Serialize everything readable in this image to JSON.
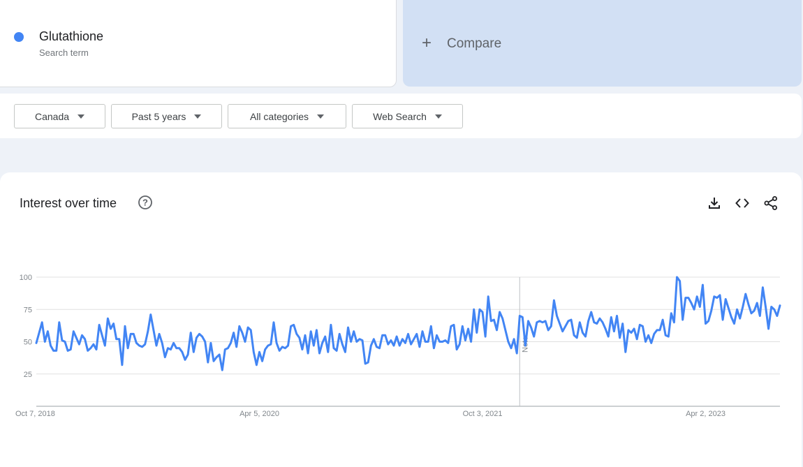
{
  "search_term": {
    "name": "Glutathione",
    "subtitle": "Search term",
    "color": "#4285f4"
  },
  "compare": {
    "label": "Compare",
    "icon": "plus-icon"
  },
  "filters": [
    {
      "label": "Canada",
      "icon": "caret-down-icon"
    },
    {
      "label": "Past 5 years",
      "icon": "caret-down-icon"
    },
    {
      "label": "All categories",
      "icon": "caret-down-icon"
    },
    {
      "label": "Web Search",
      "icon": "caret-down-icon"
    }
  ],
  "section": {
    "title": "Interest over time",
    "icons": [
      "help-icon",
      "download-icon",
      "embed-icon",
      "share-icon"
    ]
  },
  "chart_data": {
    "type": "line",
    "title": "Interest over time",
    "xlabel": "",
    "ylabel": "",
    "ylim": [
      0,
      100
    ],
    "yticks": [
      25,
      50,
      75,
      100
    ],
    "x_tick_labels": [
      "Oct 7, 2018",
      "Apr 5, 2020",
      "Oct 3, 2021",
      "Apr 2, 2023"
    ],
    "grid": true,
    "legend": "none",
    "annotation": {
      "label": "Note",
      "date": "2022-01-02"
    },
    "x_start": "2018-10-07",
    "x_step_days": 7,
    "series": [
      {
        "color": "#4285f4",
        "values": [
          49,
          57,
          65,
          50,
          58,
          47,
          43,
          43,
          65,
          51,
          50,
          43,
          44,
          58,
          53,
          48,
          55,
          52,
          43,
          45,
          48,
          44,
          63,
          55,
          47,
          68,
          60,
          64,
          52,
          52,
          32,
          62,
          45,
          56,
          56,
          49,
          47,
          46,
          48,
          58,
          71,
          59,
          47,
          56,
          49,
          38,
          45,
          44,
          49,
          45,
          45,
          42,
          36,
          40,
          57,
          42,
          53,
          56,
          54,
          50,
          34,
          49,
          35,
          38,
          40,
          28,
          44,
          45,
          49,
          57,
          46,
          62,
          57,
          50,
          61,
          59,
          42,
          32,
          42,
          35,
          44,
          47,
          48,
          65,
          49,
          43,
          46,
          45,
          47,
          62,
          63,
          56,
          53,
          44,
          55,
          41,
          58,
          47,
          59,
          41,
          49,
          54,
          42,
          63,
          45,
          43,
          56,
          48,
          42,
          61,
          50,
          58,
          50,
          52,
          51,
          33,
          34,
          47,
          52,
          46,
          45,
          55,
          55,
          48,
          51,
          47,
          54,
          47,
          52,
          49,
          56,
          48,
          52,
          56,
          46,
          58,
          50,
          50,
          62,
          45,
          55,
          50,
          50,
          51,
          49,
          62,
          63,
          44,
          48,
          62,
          51,
          60,
          50,
          75,
          57,
          75,
          73,
          54,
          85,
          66,
          67,
          59,
          73,
          68,
          59,
          50,
          45,
          52,
          41,
          70,
          69,
          47,
          66,
          61,
          54,
          65,
          66,
          65,
          66,
          59,
          62,
          82,
          70,
          64,
          58,
          62,
          66,
          67,
          55,
          53,
          65,
          57,
          54,
          66,
          73,
          65,
          64,
          68,
          65,
          60,
          54,
          69,
          58,
          70,
          53,
          64,
          42,
          59,
          57,
          60,
          52,
          63,
          62,
          50,
          55,
          49,
          56,
          59,
          59,
          67,
          55,
          54,
          72,
          65,
          100,
          97,
          67,
          84,
          84,
          80,
          75,
          85,
          77,
          94,
          64,
          66,
          74,
          85,
          84,
          86,
          67,
          83,
          76,
          69,
          64,
          75,
          68,
          77,
          87,
          79,
          72,
          74,
          80,
          70,
          92,
          77,
          60,
          77,
          75,
          70,
          78
        ]
      }
    ]
  }
}
